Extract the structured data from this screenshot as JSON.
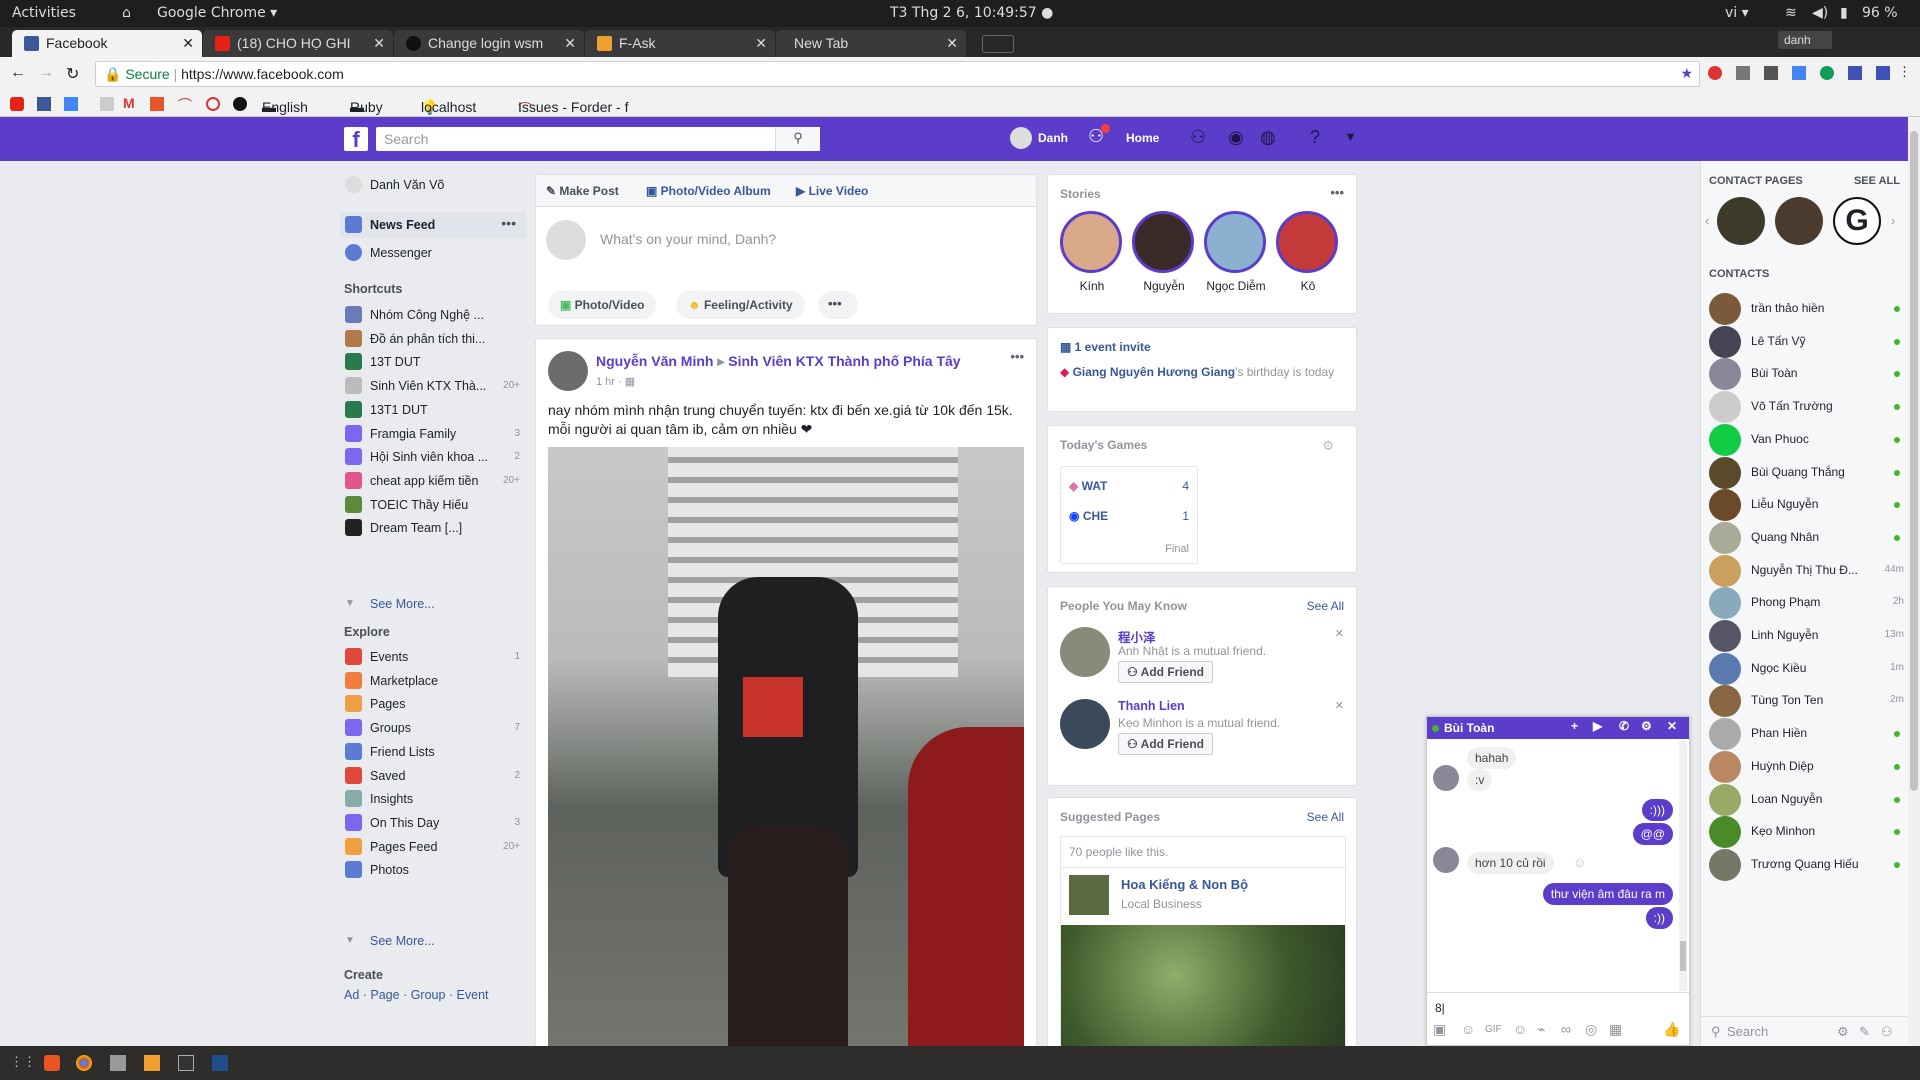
{
  "system": {
    "activities": "Activities",
    "app": "Google Chrome ▾",
    "clock": "T3 Thg 2  6, 10:49:57 ●",
    "lang": "vi ▾",
    "battery": "96 %"
  },
  "browser": {
    "tabs": [
      {
        "label": "Facebook",
        "active": true
      },
      {
        "label": "(18) CHO HỌ GHI"
      },
      {
        "label": "Change login wsm"
      },
      {
        "label": "F-Ask"
      },
      {
        "label": "New Tab"
      }
    ],
    "profile": "danh",
    "secure": "Secure",
    "url": "https://www.facebook.com",
    "bookmarks": [
      "English",
      "Ruby",
      "localhost",
      "Issues - Forder - f"
    ]
  },
  "fb": {
    "search_placeholder": "Search",
    "user": "Danh",
    "home": "Home",
    "left": {
      "profile": "Danh Văn Võ",
      "newsfeed": "News Feed",
      "messenger": "Messenger",
      "shortcuts_title": "Shortcuts",
      "shortcuts": [
        {
          "label": "Nhóm Công Nghệ ...",
          "count": ""
        },
        {
          "label": "Đồ án phân tích thi...",
          "count": ""
        },
        {
          "label": "13T DUT",
          "count": ""
        },
        {
          "label": "Sinh Viên KTX Thà...",
          "count": "20+"
        },
        {
          "label": "13T1 DUT",
          "count": ""
        },
        {
          "label": "Framgia Family",
          "count": "3"
        },
        {
          "label": "Hội Sinh viên khoa ...",
          "count": "2"
        },
        {
          "label": "cheat app kiếm tiền",
          "count": "20+"
        },
        {
          "label": "TOEIC Thầy Hiếu",
          "count": ""
        },
        {
          "label": "Dream Team [...]",
          "count": ""
        }
      ],
      "see_more": "See More...",
      "explore_title": "Explore",
      "explore": [
        {
          "label": "Events",
          "count": "1"
        },
        {
          "label": "Marketplace",
          "count": ""
        },
        {
          "label": "Pages",
          "count": ""
        },
        {
          "label": "Groups",
          "count": "7"
        },
        {
          "label": "Friend Lists",
          "count": ""
        },
        {
          "label": "Saved",
          "count": "2"
        },
        {
          "label": "Insights",
          "count": ""
        },
        {
          "label": "On This Day",
          "count": "3"
        },
        {
          "label": "Pages Feed",
          "count": "20+"
        },
        {
          "label": "Photos",
          "count": ""
        }
      ],
      "see_more2": "See More...",
      "create_title": "Create",
      "create_links": "Ad · Page · Group · Event"
    },
    "composer": {
      "make_post": "Make Post",
      "album": "Photo/Video Album",
      "live": "Live Video",
      "placeholder": "What's on your mind, Danh?",
      "photo": "Photo/Video",
      "feeling": "Feeling/Activity"
    },
    "post": {
      "author": "Nguyễn Văn Minh",
      "group": "Sinh Viên KTX Thành phố Phía Tây",
      "time": "1 hr ·",
      "text": "nay nhóm mình nhận trung chuyển tuyến: ktx đi bến xe.giá từ 10k đến 15k.\nmỗi người ai quan tâm ib, cảm ơn nhiều ❤"
    },
    "stories": {
      "title": "Stories",
      "items": [
        "Kính",
        "Nguyễn",
        "Ngọc Diễm",
        "Kô"
      ]
    },
    "events": {
      "invite": "1 event invite",
      "bday_name": "Giang Nguyên Hương Giang",
      "bday_rest": "'s birthday is today"
    },
    "games": {
      "title": "Today's Games",
      "teams": [
        {
          "name": "WAT",
          "score": "4"
        },
        {
          "name": "CHE",
          "score": "1"
        }
      ],
      "final": "Final"
    },
    "pymk": {
      "title": "People You May Know",
      "see_all": "See All",
      "people": [
        {
          "name": "程小泽",
          "mutual": "Anh Nhật is a mutual friend.",
          "btn": "Add Friend"
        },
        {
          "name": "Thanh Lien",
          "mutual": "Kẹo Minhon is a mutual friend.",
          "btn": "Add Friend"
        }
      ]
    },
    "suggested": {
      "title": "Suggested Pages",
      "see_all": "See All",
      "likes": "70 people like this.",
      "name": "Hoa Kiểng & Non Bộ",
      "type": "Local Business"
    },
    "contact_pages": {
      "title": "CONTACT PAGES",
      "see_all": "SEE ALL"
    },
    "contacts_title": "CONTACTS",
    "contacts": [
      {
        "name": "trần thảo hiền",
        "status": ""
      },
      {
        "name": "Lê Tấn Vỹ",
        "status": ""
      },
      {
        "name": "Bùi Toàn",
        "status": ""
      },
      {
        "name": "Võ Tấn Trường",
        "status": ""
      },
      {
        "name": "Van Phuoc",
        "status": ""
      },
      {
        "name": "Bùi Quang Thắng",
        "status": ""
      },
      {
        "name": "Liễu Nguyễn",
        "status": ""
      },
      {
        "name": "Quang Nhân",
        "status": ""
      },
      {
        "name": "Nguyễn Thị Thu Đ...",
        "status": "44m"
      },
      {
        "name": "Phong Phạm",
        "status": "2h"
      },
      {
        "name": "Linh Nguyễn",
        "status": "13m"
      },
      {
        "name": "Ngọc Kiều",
        "status": "1m"
      },
      {
        "name": "Tùng Ton Ten",
        "status": "2m"
      },
      {
        "name": "Phan Hiền",
        "status": ""
      },
      {
        "name": "Huỳnh Diệp",
        "status": ""
      },
      {
        "name": "Loan Nguyễn",
        "status": ""
      },
      {
        "name": "Kẹo Minhon",
        "status": ""
      },
      {
        "name": "Trương Quang Hiếu",
        "status": ""
      }
    ],
    "contacts_search": "Search",
    "chat": {
      "name": "Bùi Toàn",
      "messages": [
        {
          "dir": "in",
          "text": "hahah"
        },
        {
          "dir": "in",
          "text": ":v"
        },
        {
          "dir": "out",
          "text": ":)))"
        },
        {
          "dir": "out",
          "text": "@@"
        },
        {
          "dir": "in",
          "text": "hơn 10 củ rồi"
        },
        {
          "dir": "out",
          "text": "thư viện âm đâu ra m"
        },
        {
          "dir": "out",
          "text": ":))"
        }
      ],
      "input": "8|"
    }
  }
}
